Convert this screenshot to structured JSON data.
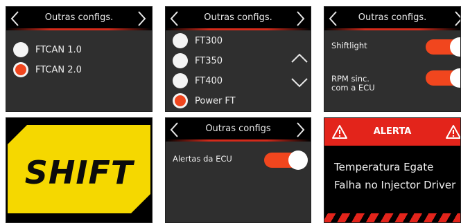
{
  "screens": {
    "can_protocol": {
      "title": "Outras configs.",
      "options": [
        {
          "label": "FTCAN 1.0",
          "selected": false
        },
        {
          "label": "FTCAN 2.0",
          "selected": true
        }
      ]
    },
    "ecu_model": {
      "title": "Outras configs.",
      "options": [
        {
          "label": "FT300",
          "selected": false
        },
        {
          "label": "FT350",
          "selected": false
        },
        {
          "label": "FT400",
          "selected": false
        },
        {
          "label": "Power FT",
          "selected": true
        }
      ]
    },
    "toggles": {
      "title": "Outras configs.",
      "items": [
        {
          "label": "Shiftlight",
          "on": true
        },
        {
          "label_line1": "RPM sinc.",
          "label_line2": "com a ECU",
          "on": true
        }
      ]
    },
    "shift": {
      "text": "SHIFT"
    },
    "ecu_alerts": {
      "title": "Outras configs",
      "items": [
        {
          "label": "Alertas da ECU",
          "on": true
        }
      ]
    },
    "alert": {
      "title": "ALERTA",
      "lines": [
        "Temperatura Egate",
        "Falha no Injector Driver"
      ]
    }
  },
  "colors": {
    "accent": "#f1461e",
    "alert_red": "#e3241b",
    "shift_yellow": "#f5d800",
    "panel_bg": "#2f2f2f"
  },
  "icons": [
    "chevron-left-icon",
    "chevron-right-icon",
    "chevron-up-icon",
    "chevron-down-icon",
    "warning-icon"
  ]
}
